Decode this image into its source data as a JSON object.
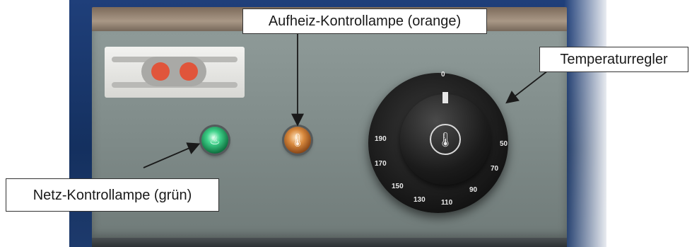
{
  "labels": {
    "aufheiz": "Aufheiz-Kontrollampe (orange)",
    "temperatur": "Temperaturregler",
    "netz": "Netz-Kontrollampe (grün)"
  },
  "dial": {
    "marks": [
      "0",
      "50",
      "70",
      "90",
      "110",
      "130",
      "150",
      "170",
      "190"
    ]
  },
  "colors": {
    "lamp_green": "#3fd28a",
    "lamp_orange": "#d98a3e",
    "logo_dot": "#e0553b",
    "panel": "#7f8b89",
    "background": "#1f3f7a"
  },
  "icons": {
    "lamp_green": "heater-icon",
    "lamp_orange": "thermometer-icon",
    "dial": "thermometer-icon"
  }
}
